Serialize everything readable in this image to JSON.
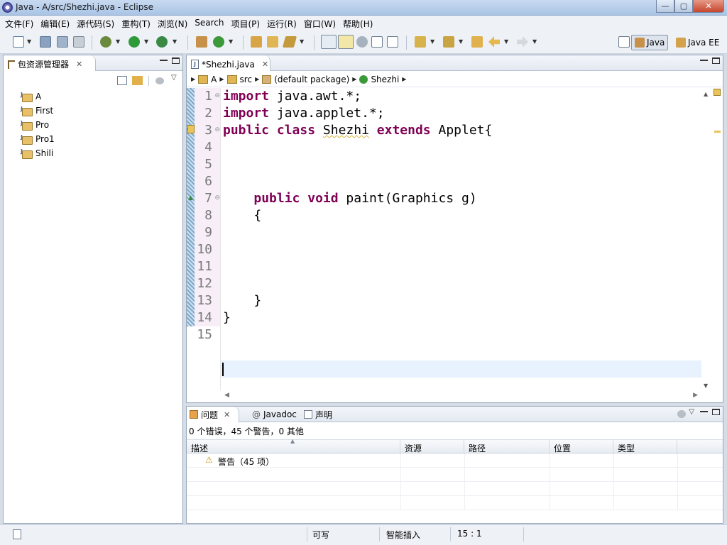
{
  "window": {
    "title": "Java  -  A/src/Shezhi.java  -  Eclipse",
    "min_symbol": "—",
    "max_symbol": "▢",
    "close_symbol": "✕"
  },
  "menu": [
    "文件(F)",
    "编辑(E)",
    "源代码(S)",
    "重构(T)",
    "浏览(N)",
    "Search",
    "项目(P)",
    "运行(R)",
    "窗口(W)",
    "帮助(H)"
  ],
  "perspectives": {
    "java": "Java",
    "java_ee": "Java EE"
  },
  "package_explorer": {
    "title": "包资源管理器",
    "projects": [
      "A",
      "First",
      "Pro",
      "Pro1",
      "Shili"
    ]
  },
  "editor": {
    "tab_label": "*Shezhi.java",
    "breadcrumb": [
      "A",
      "src",
      "(default package)",
      "Shezhi"
    ],
    "line_numbers": [
      "1",
      "2",
      "3",
      "4",
      "5",
      "6",
      "7",
      "8",
      "9",
      "10",
      "11",
      "12",
      "13",
      "14",
      "15"
    ],
    "code": {
      "l1_kw": "import",
      "l1_rest": " java.awt.*;",
      "l2_kw": "import",
      "l2_rest": " java.applet.*;",
      "l3_kw1": "public",
      "l3_kw2": "class",
      "l3_name": "Shezhi",
      "l3_kw3": "extends",
      "l3_rest": " Applet{",
      "l7_kw1": "public",
      "l7_kw2": "void",
      "l7_rest": " paint(Graphics g)",
      "l8": "{",
      "l13": "}",
      "l14": "}"
    }
  },
  "problems_view": {
    "tabs": [
      "问题",
      "Javadoc",
      "声明"
    ],
    "summary": "0 个错误，45 个警告，0 其他",
    "columns": [
      "描述",
      "资源",
      "路径",
      "位置",
      "类型"
    ],
    "rows": [
      {
        "description": "警告（45 项）"
      }
    ]
  },
  "status_bar": {
    "writable": "可写",
    "insert_mode": "智能插入",
    "position": "15 : 1"
  },
  "colors": {
    "keyword": "#7f0055",
    "current_line": "#e8f2fe",
    "line_number": "#7a7a7a"
  }
}
